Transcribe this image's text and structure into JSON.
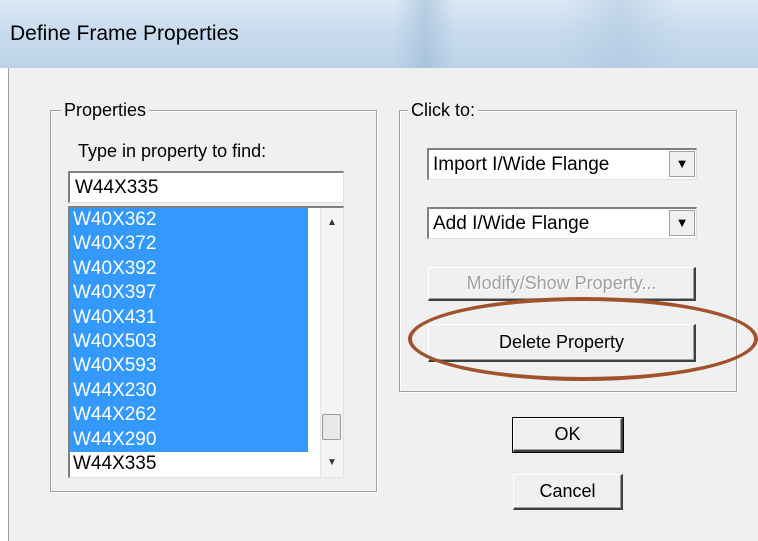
{
  "window": {
    "title": "Define Frame Properties"
  },
  "properties": {
    "group_label": "Properties",
    "find_label": "Type in property to find:",
    "find_value": "W44X335",
    "items": [
      {
        "label": "W40X362",
        "selected": true
      },
      {
        "label": "W40X372",
        "selected": true
      },
      {
        "label": "W40X392",
        "selected": true
      },
      {
        "label": "W40X397",
        "selected": true
      },
      {
        "label": "W40X431",
        "selected": true
      },
      {
        "label": "W40X503",
        "selected": true
      },
      {
        "label": "W40X593",
        "selected": true
      },
      {
        "label": "W44X230",
        "selected": true
      },
      {
        "label": "W44X262",
        "selected": true
      },
      {
        "label": "W44X290",
        "selected": true
      },
      {
        "label": "W44X335",
        "selected": false
      }
    ]
  },
  "click_to": {
    "group_label": "Click to:",
    "import_select": "Import I/Wide Flange",
    "add_select": "Add I/Wide Flange",
    "modify_label": "Modify/Show Property...",
    "delete_label": "Delete Property"
  },
  "buttons": {
    "ok": "OK",
    "cancel": "Cancel"
  },
  "colors": {
    "selection": "#3399ff",
    "annotation_ellipse": "#a0522d",
    "dialog_bg": "#f0f0f0"
  }
}
